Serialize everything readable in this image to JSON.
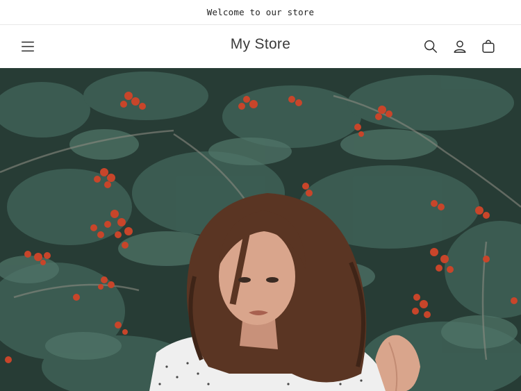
{
  "announcement": {
    "text": "Welcome to our store"
  },
  "header": {
    "logo": "My Store",
    "icons": {
      "menu": "hamburger-menu-icon",
      "search": "search-icon",
      "account": "account-icon",
      "cart": "cart-icon"
    }
  },
  "hero": {
    "image": "woman-with-curly-hair-in-front-of-rowan-berry-bush",
    "colors": {
      "foliage": "#2f4a42",
      "berries": "#c8452a",
      "hair": "#5a3523",
      "skin": "#d9a58c",
      "shirt": "#efefef"
    }
  }
}
